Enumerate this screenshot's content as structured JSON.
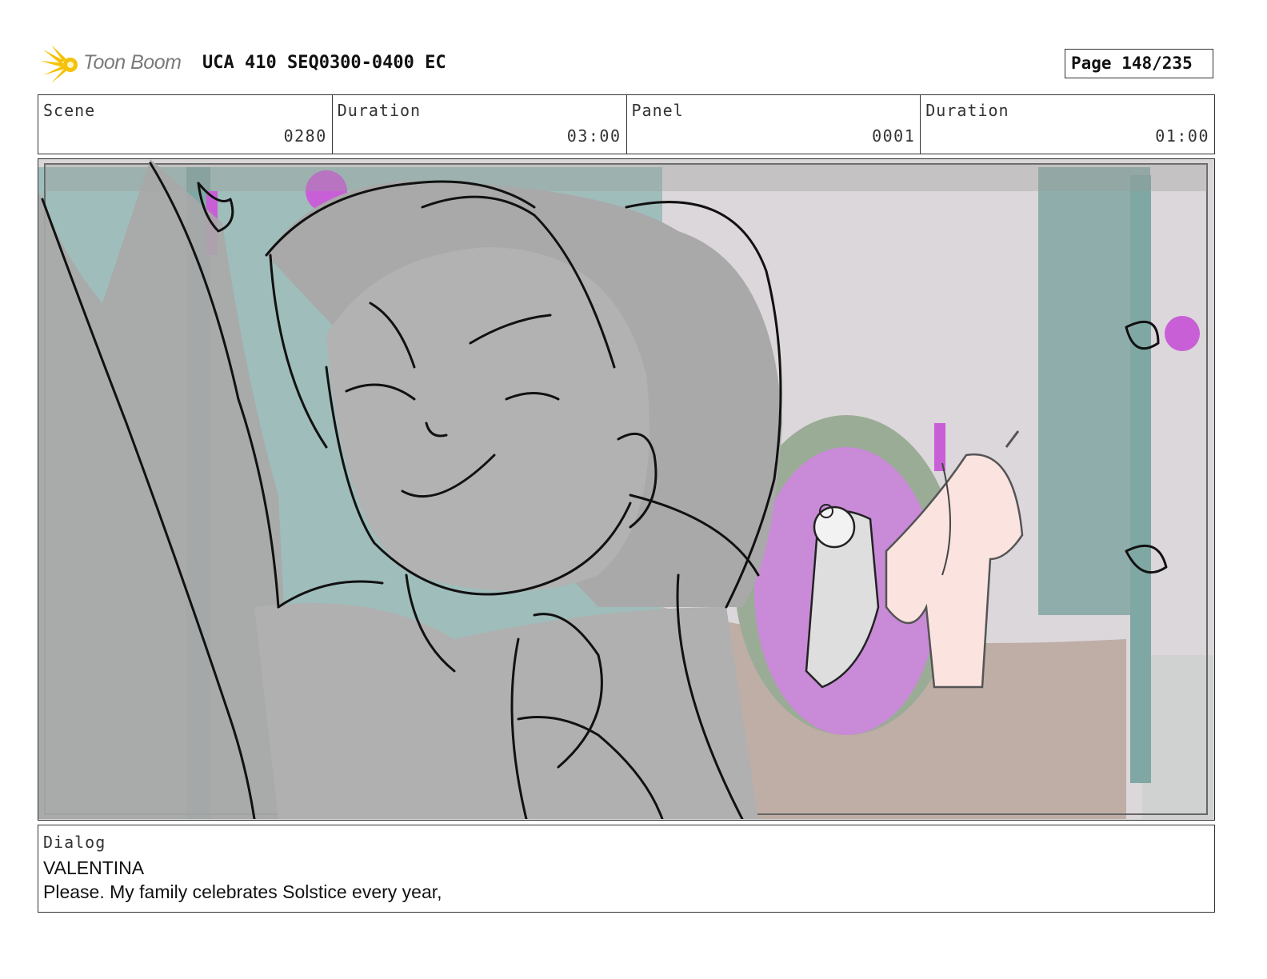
{
  "header": {
    "logo_text": "Toon Boom",
    "title": "UCA 410 SEQ0300-0400 EC",
    "page": "Page 148/235"
  },
  "info": {
    "scene_label": "Scene",
    "scene_value": "0280",
    "scene_duration_label": "Duration",
    "scene_duration_value": "03:00",
    "panel_label": "Panel",
    "panel_value": "0001",
    "panel_duration_label": "Duration",
    "panel_duration_value": "01:00"
  },
  "dialog": {
    "label": "Dialog",
    "speaker": "VALENTINA",
    "line": "Please. My family celebrates Solstice every year,"
  },
  "colors": {
    "logo_star": "#f5c20a",
    "background_teal": "#8fb3b0",
    "door_magenta": "#c98ad8",
    "sketch_fill": "#b0b0b0",
    "unicorn_pink": "#fbe4e0"
  }
}
